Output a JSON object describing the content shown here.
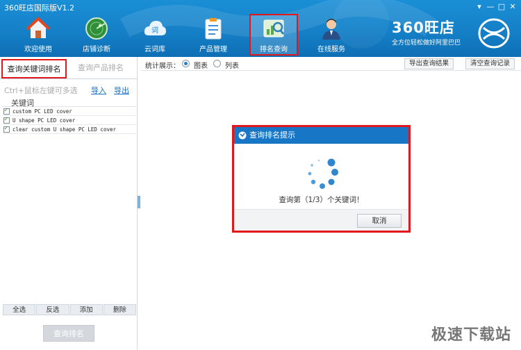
{
  "window": {
    "title": "360旺店国际版V1.2",
    "controls": [
      "▾",
      "—",
      "□",
      "✕"
    ]
  },
  "nav": {
    "items": [
      {
        "label": "欢迎使用",
        "icon": "home-icon"
      },
      {
        "label": "店铺诊断",
        "icon": "radar-icon"
      },
      {
        "label": "云词库",
        "icon": "cloud-icon"
      },
      {
        "label": "产品管理",
        "icon": "clipboard-icon"
      },
      {
        "label": "排名查询",
        "icon": "magnifier-chart-icon",
        "active": true
      },
      {
        "label": "在线服务",
        "icon": "agent-icon"
      }
    ]
  },
  "brand": {
    "name": "360旺店",
    "slogan": "全方位轻松做好阿里巴巴"
  },
  "left": {
    "tab_active": "查询关键词排名",
    "tab_inactive": "查询产品排名",
    "hint": "Ctrl+鼠标左键可多选",
    "import": "导入",
    "export": "导出",
    "column_header": "关键词",
    "keywords": [
      "custom PC LED cover",
      "U shape PC LED cover",
      "clear custom U shape PC LED cover"
    ],
    "buttons": {
      "select_all": "全选",
      "invert": "反选",
      "add": "添加",
      "delete": "删除"
    },
    "query_button": "查询排名"
  },
  "toolbar": {
    "stat_label": "统计展示：",
    "option_chart": "图表",
    "option_list": "列表",
    "selected": "图表",
    "export_results": "导出查询结果",
    "clear_records": "清空查询记录"
  },
  "dialog": {
    "title": "查询排名提示",
    "message": "查询第（1/3）个关键词！",
    "cancel": "取消"
  },
  "watermark": "极速下载站",
  "colors": {
    "header_blue": "#1580c8",
    "highlight_red": "#e2171c",
    "dialog_blue": "#1876c7",
    "link_blue": "#1a6fc0"
  }
}
